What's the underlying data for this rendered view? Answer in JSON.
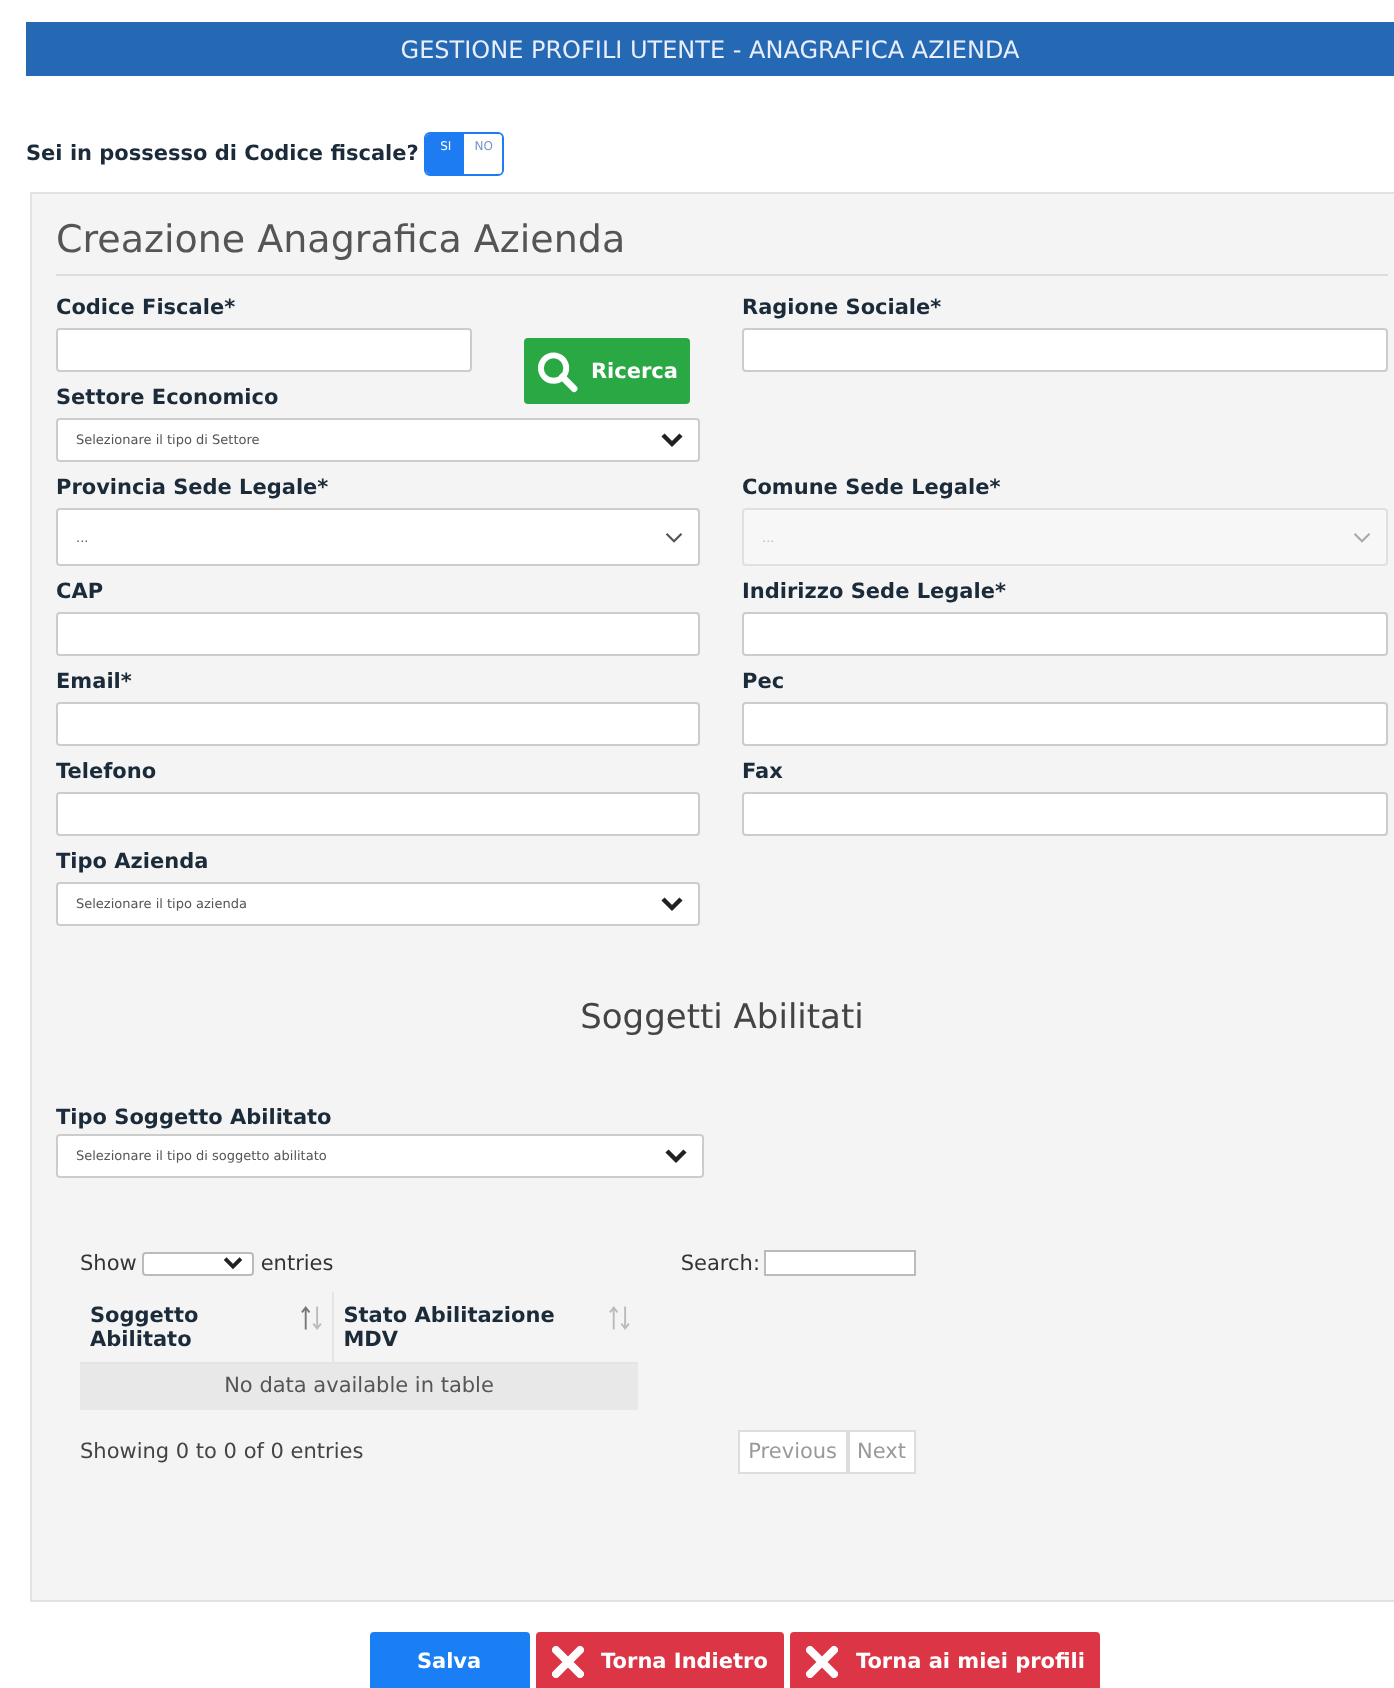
{
  "header": {
    "title": "GESTIONE PROFILI UTENTE - ANAGRAFICA AZIENDA"
  },
  "codice_question": {
    "label": "Sei in possesso di Codice fiscale?",
    "options": [
      {
        "label": "SI",
        "selected": true
      },
      {
        "label": "NO",
        "selected": false
      }
    ]
  },
  "form": {
    "title": "Creazione Anagrafica Azienda",
    "rows": [
      [
        {
          "label": "Codice Fiscale*",
          "kind": "search",
          "button": "Ricerca"
        },
        {
          "label": "Ragione Sociale*",
          "kind": "text"
        }
      ],
      [
        {
          "label": "Settore Economico",
          "kind": "select",
          "placeholder": "Selezionare il tipo di Settore",
          "disabled": false
        }
      ],
      [
        {
          "label": "Provincia Sede Legale*",
          "kind": "tallselect",
          "placeholder": "...",
          "disabled": false
        },
        {
          "label": "Comune Sede Legale*",
          "kind": "tallselect",
          "placeholder": "...",
          "disabled": true
        }
      ],
      [
        {
          "label": "CAP",
          "kind": "text"
        },
        {
          "label": "Indirizzo Sede Legale*",
          "kind": "text"
        }
      ],
      [
        {
          "label": "Email*",
          "kind": "text"
        },
        {
          "label": "Pec",
          "kind": "text"
        }
      ],
      [
        {
          "label": "Telefono",
          "kind": "text"
        },
        {
          "label": "Fax",
          "kind": "text"
        }
      ],
      [
        {
          "label": "Tipo Azienda",
          "kind": "select",
          "placeholder": "Selezionare il tipo azienda",
          "disabled": false
        }
      ]
    ]
  },
  "soggetti": {
    "title": "Soggetti Abilitati",
    "type_label": "Tipo Soggetto Abilitato",
    "type_placeholder": "Selezionare il tipo di soggetto abilitato",
    "show_label": "Show",
    "entries_label": "entries",
    "search_label": "Search:",
    "columns": [
      "Soggetto Abilitato",
      "Stato Abilitazione MDV"
    ],
    "empty": "No data available in table",
    "info": "Showing 0 to 0 of 0 entries",
    "pagination": [
      {
        "label": "Previous",
        "disabled": true
      },
      {
        "label": "Next",
        "disabled": true
      }
    ]
  },
  "buttons": [
    {
      "label": "Salva",
      "kind": "primary"
    },
    {
      "label": "Torna Indietro",
      "kind": "danger"
    },
    {
      "label": "Torna ai miei profili",
      "kind": "danger"
    }
  ]
}
